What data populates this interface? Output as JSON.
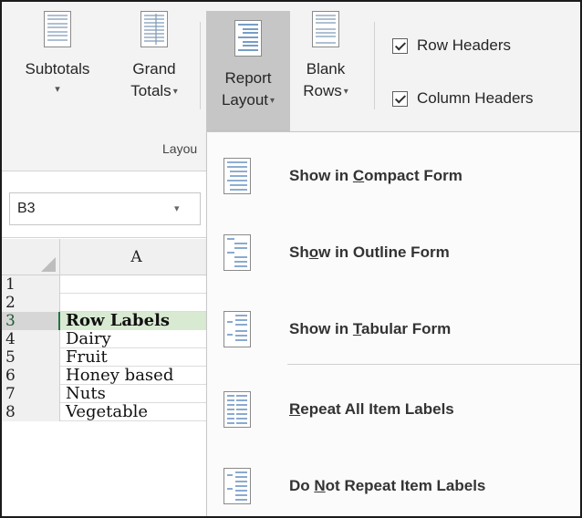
{
  "ribbon": {
    "buttons": [
      {
        "line1": "Subtotals",
        "line2": ""
      },
      {
        "line1": "Grand",
        "line2": "Totals"
      },
      {
        "line1": "Report",
        "line2": "Layout"
      },
      {
        "line1": "Blank",
        "line2": "Rows"
      }
    ],
    "checkboxes": [
      {
        "label": "Row Headers",
        "checked": true
      },
      {
        "label": "Column Headers",
        "checked": true
      }
    ],
    "group_label": "Layou"
  },
  "namebox": {
    "value": "B3"
  },
  "grid": {
    "column_header": "A",
    "rows": [
      {
        "num": "1",
        "a": ""
      },
      {
        "num": "2",
        "a": ""
      },
      {
        "num": "3",
        "a": "Row Labels"
      },
      {
        "num": "4",
        "a": "Dairy"
      },
      {
        "num": "5",
        "a": "Fruit"
      },
      {
        "num": "6",
        "a": "Honey based"
      },
      {
        "num": "7",
        "a": "Nuts"
      },
      {
        "num": "8",
        "a": "Vegetable"
      }
    ]
  },
  "menu": {
    "items": [
      {
        "pre": "Show in ",
        "key": "C",
        "post": "ompact Form",
        "icon": "compact-form-icon"
      },
      {
        "pre": "Sh",
        "key": "o",
        "post": "w in Outline Form",
        "icon": "outline-form-icon"
      },
      {
        "pre": "Show in ",
        "key": "T",
        "post": "abular Form",
        "icon": "tabular-form-icon"
      },
      {
        "pre": "",
        "key": "R",
        "post": "epeat All Item Labels",
        "icon": "repeat-labels-icon"
      },
      {
        "pre": "Do ",
        "key": "N",
        "post": "ot Repeat Item Labels",
        "icon": "no-repeat-labels-icon"
      }
    ]
  },
  "colors": {
    "ribbon_bg": "#f3f3f3",
    "pressed_button": "#c6c6c6",
    "row_labels_fill": "#d9ead3",
    "excel_green": "#217346"
  }
}
